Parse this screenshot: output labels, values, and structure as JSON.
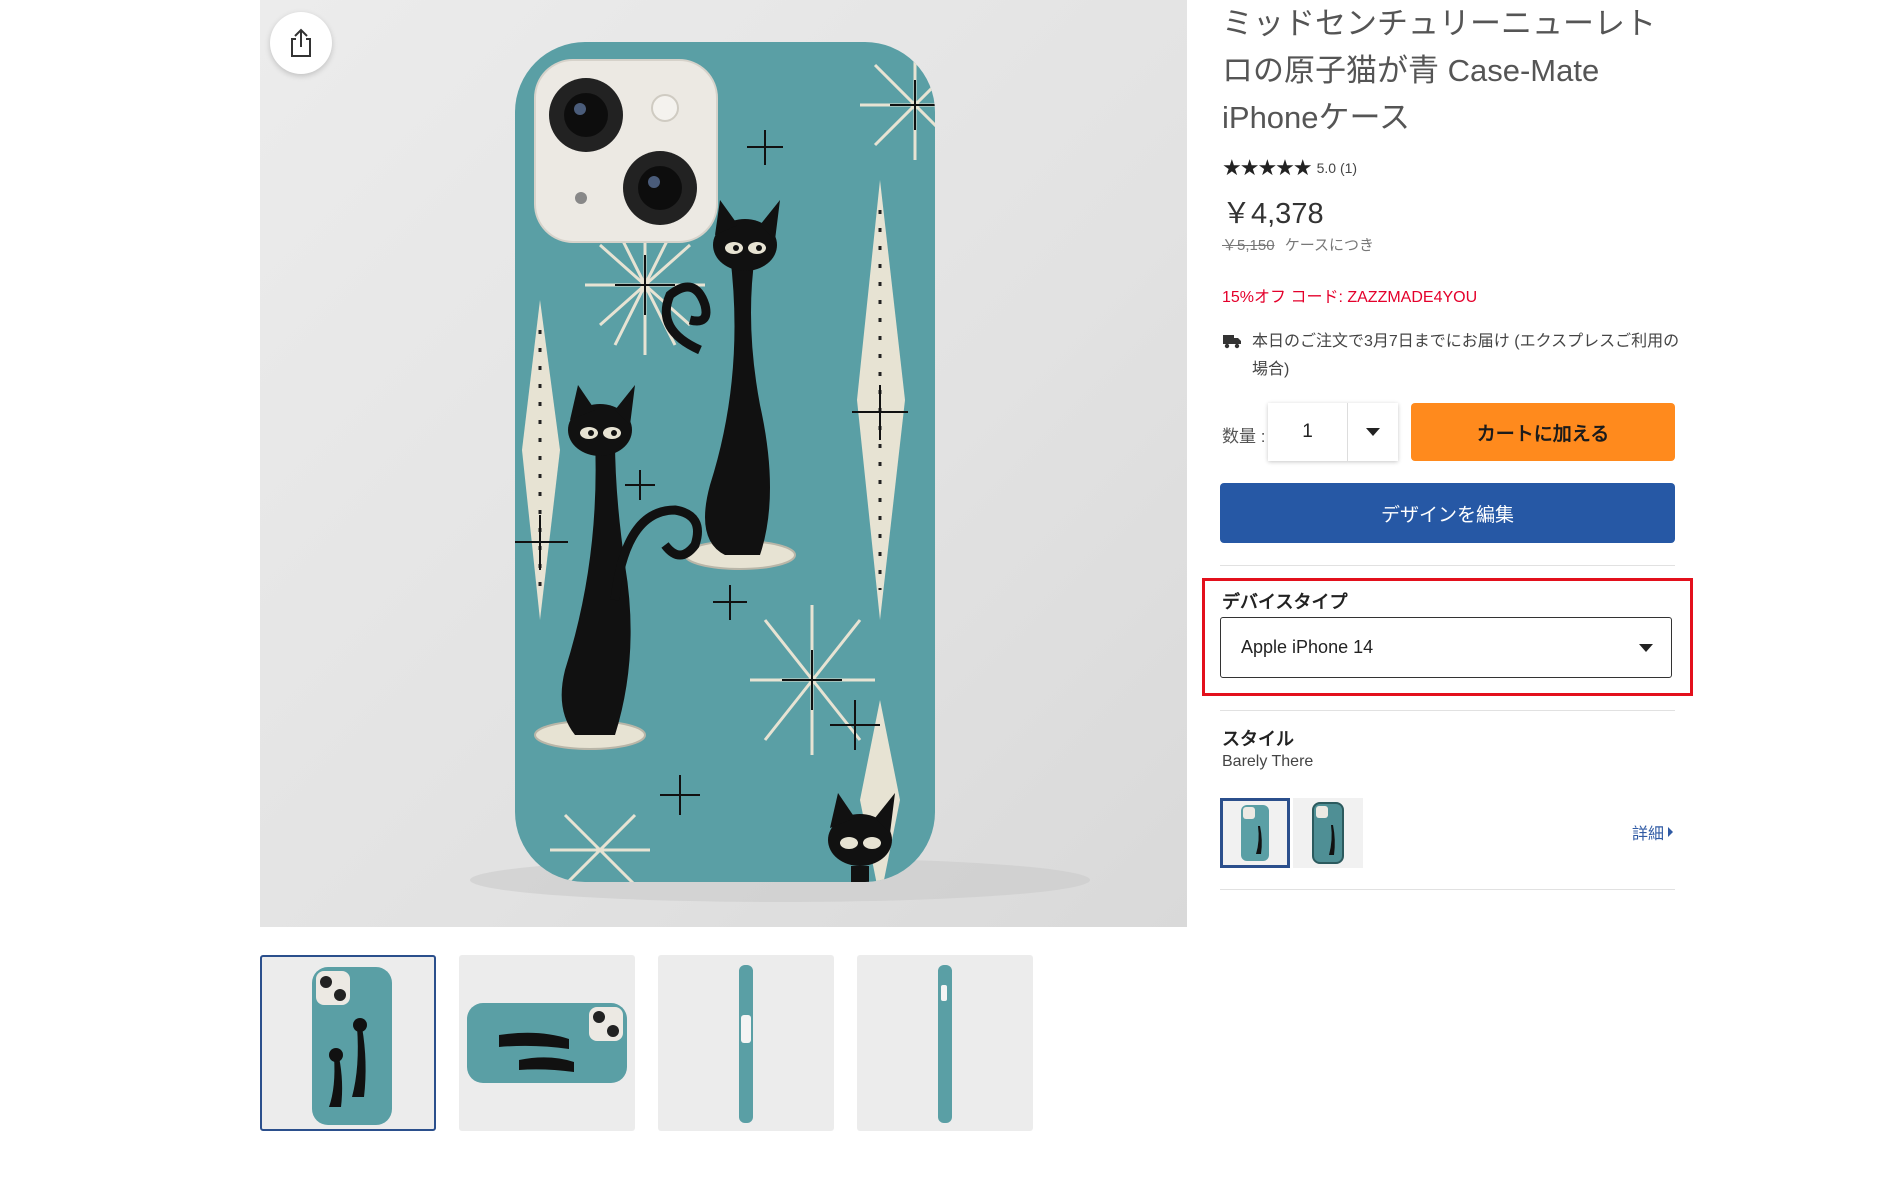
{
  "product": {
    "title": "ミッドセンチュリーニューレトロの原子猫が青 Case-Mate iPhoneケース",
    "stars": "★★★★★",
    "rating_text": "5.0 (1)",
    "price": "￥4,378",
    "original_price": "￥5,150",
    "per_unit": "ケースにつき",
    "discount": "15%オフ コード: ZAZZMADE4YOU",
    "delivery": "本日のご注文で3月7日までにお届け (エクスプレスご利用の場合)"
  },
  "purchase": {
    "quantity_label": "数量 :",
    "quantity_value": "1",
    "add_to_cart": "カートに加える",
    "edit_design": "デザインを編集"
  },
  "options": {
    "device_label": "デバイスタイプ",
    "device_value": "Apple iPhone 14",
    "style_label": "スタイル",
    "style_value": "Barely There",
    "detail_link": "詳細"
  },
  "colors": {
    "case_teal": "#5a9fa5",
    "cart_orange": "#ff8a1d",
    "edit_blue": "#2658a5",
    "highlight_red": "#e3101c",
    "discount_red": "#e4002b"
  },
  "icons": [
    "share-icon",
    "truck-icon",
    "chevron-down-icon",
    "chevron-right-icon"
  ]
}
